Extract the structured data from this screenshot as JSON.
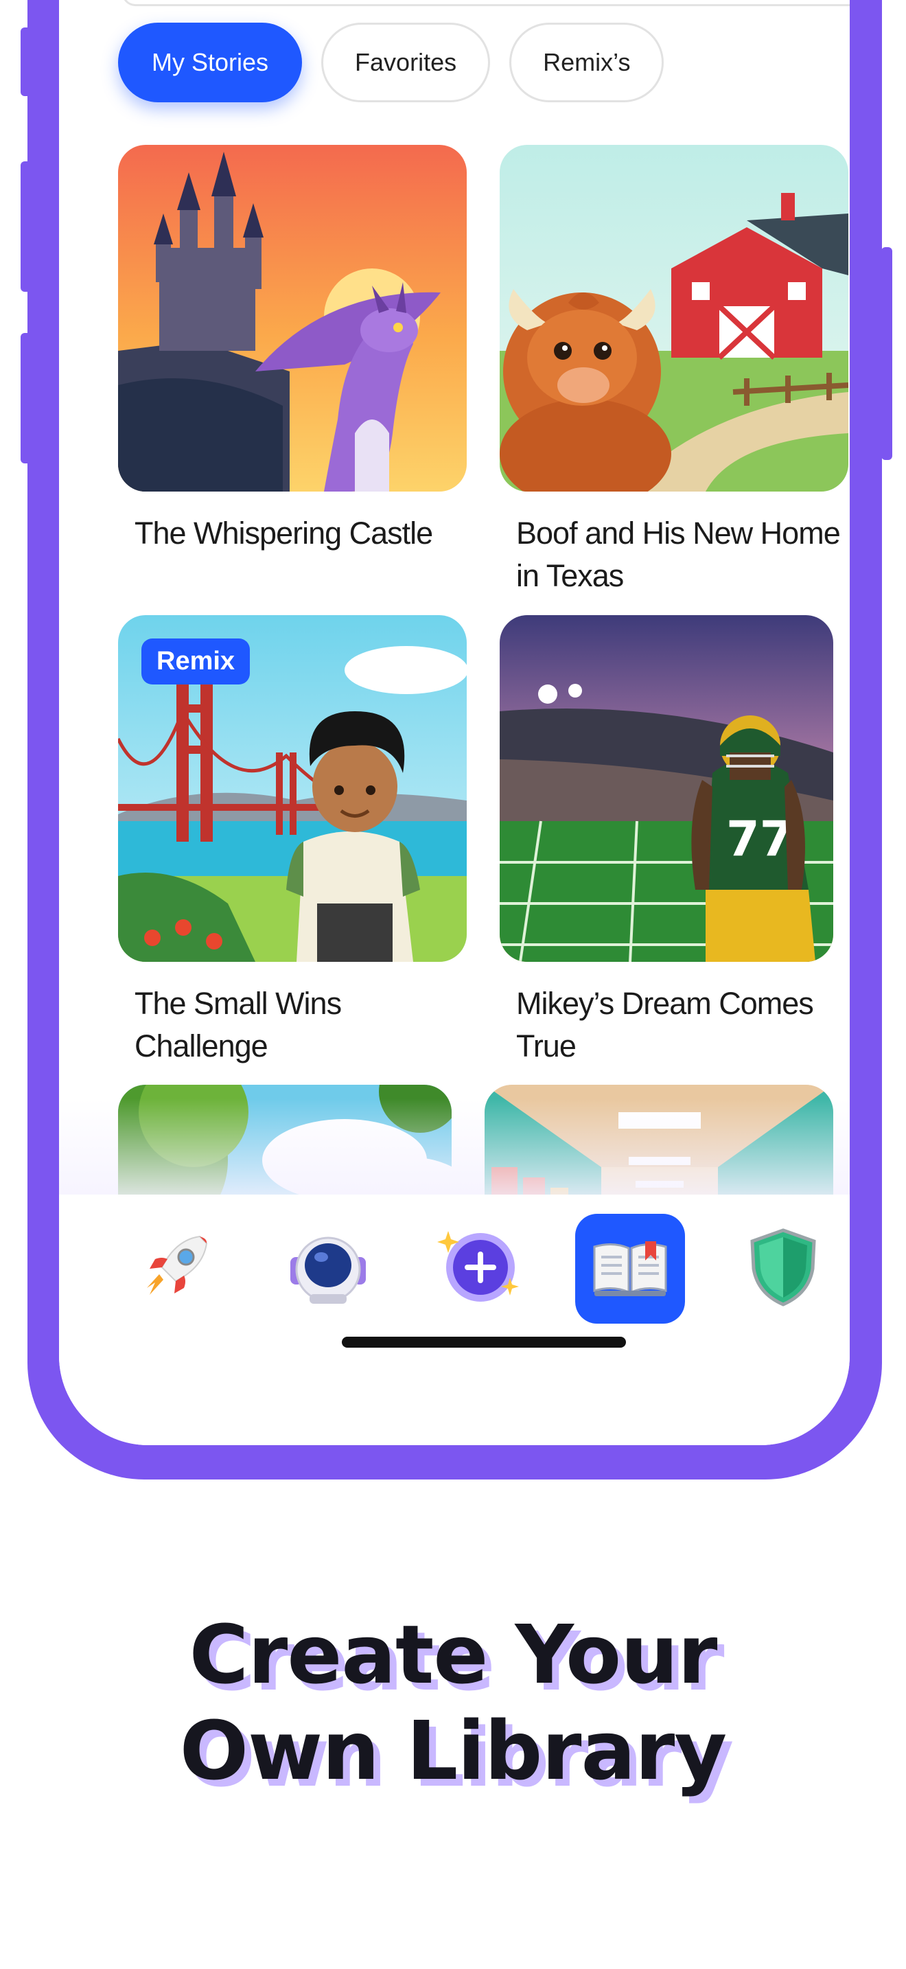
{
  "tabs": [
    {
      "label": "My Stories",
      "active": true
    },
    {
      "label": "Favorites",
      "active": false
    },
    {
      "label": "Remix’s",
      "active": false
    }
  ],
  "stories": [
    {
      "title": "The Whispering Castle",
      "image": "castle-dragon-illustration",
      "remix": false
    },
    {
      "title": "Boof and His New Home in Texas",
      "image": "highland-cow-barn-illustration",
      "remix": false
    },
    {
      "title": "The Small Wins Challenge",
      "image": "boy-golden-gate-illustration",
      "remix": true,
      "badge": "Remix"
    },
    {
      "title": "Mikey’s Dream Comes True",
      "image": "football-player-stadium-illustration",
      "remix": false
    },
    {
      "title": "",
      "image": "boy-forest-giraffe-illustration",
      "remix": false
    },
    {
      "title": "",
      "image": "school-hallway-girl-illustration",
      "remix": false
    }
  ],
  "bottom_nav": [
    {
      "icon": "rocket-icon",
      "active": false
    },
    {
      "icon": "astronaut-helmet-icon",
      "active": false
    },
    {
      "icon": "create-plus-icon",
      "active": false
    },
    {
      "icon": "open-book-icon",
      "active": true
    },
    {
      "icon": "shield-icon",
      "active": false
    }
  ],
  "headline": {
    "line1": "Create Your",
    "line2": "Own Library"
  },
  "colors": {
    "accent": "#1F58FF",
    "phone_frame": "#7C56F0",
    "headline_shadow": "#C9B8FF"
  }
}
